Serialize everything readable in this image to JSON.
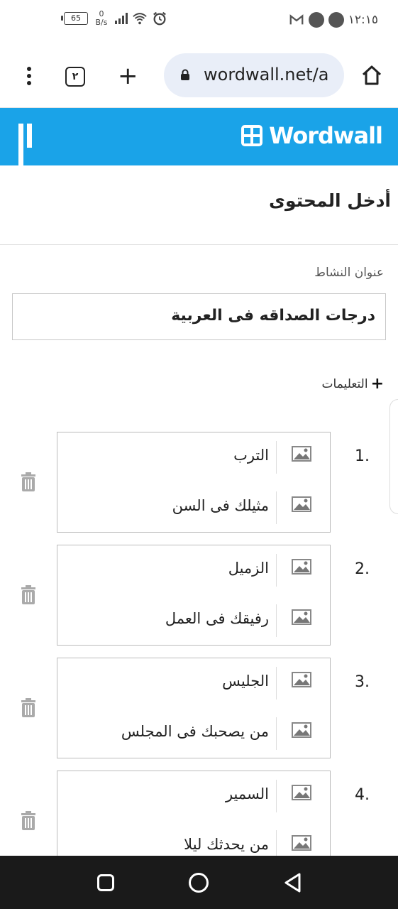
{
  "status_bar": {
    "battery": "65",
    "net_speed_value": "0",
    "net_speed_unit": "B/s",
    "time": "١٢:١٥",
    "icons": [
      "signal-icon",
      "wifi-icon",
      "alarm-icon",
      "gmail-icon",
      "phone-icon",
      "app-notification-icon"
    ]
  },
  "browser": {
    "tab_count": "٢",
    "url": "wordwall.net/a",
    "menu_icon": "more-vert-icon",
    "new_tab_icon": "plus-icon",
    "home_icon": "home-icon",
    "lock_icon": "lock-icon"
  },
  "app_header": {
    "brand": "Wordwall",
    "accent_color": "#1aa3e8"
  },
  "page": {
    "heading": "أدخل المحتوى",
    "activity_title_label": "عنوان النشاط",
    "activity_title_value": "درجات الصداقه فى العربية",
    "instructions_toggle": "التعليمات"
  },
  "items": [
    {
      "number": "1.",
      "keyword": "الترب",
      "definition": "مثيلك فى السن"
    },
    {
      "number": "2.",
      "keyword": "الزميل",
      "definition": "رفيقك فى العمل"
    },
    {
      "number": "3.",
      "keyword": "الجليس",
      "definition": "من يصحبك فى المجلس"
    },
    {
      "number": "4.",
      "keyword": "السمير",
      "definition": "من يحدثك ليلا"
    }
  ]
}
